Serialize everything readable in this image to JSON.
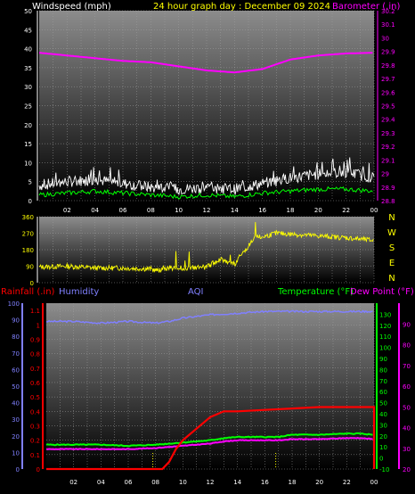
{
  "header": {
    "windspeed_label": "Windspeed (mph)",
    "title": "24 hour graph day : December 09 2024",
    "barometer_label": "Barometer (.in)"
  },
  "lower_header": {
    "rainfall_label": "Rainfall (.in)",
    "humidity_label": "Humidity",
    "aqi_label": "AQI",
    "temperature_label": "Temperature (°F)",
    "dewpoint_label": "Dew Point (°F)"
  },
  "direction_labels": [
    "N",
    "W",
    "S",
    "E",
    "N"
  ],
  "colors": {
    "wind_avg": "#00ff00",
    "wind_gust": "#ffffff",
    "barometer": "#ff00ff",
    "direction": "#ffff00",
    "rainfall": "#ff0000",
    "humidity": "#8080ff",
    "temperature": "#00ff00",
    "dewpoint": "#ff00ff",
    "title": "#ffff00",
    "aqi": "#8080ff",
    "rain_markers": "#ffff00"
  },
  "chart_data": [
    {
      "type": "line",
      "name": "wind-barometer",
      "x_ticks": [
        "02",
        "04",
        "06",
        "08",
        "10",
        "12",
        "14",
        "16",
        "18",
        "20",
        "22",
        "00"
      ],
      "xlim": [
        0,
        24
      ],
      "left_axis": {
        "label": "Windspeed (mph)",
        "ylim": [
          0,
          50
        ],
        "ticks": [
          "0",
          "5",
          "10",
          "15",
          "20",
          "25",
          "30",
          "35",
          "40",
          "45",
          "50"
        ]
      },
      "right_axis": {
        "label": "Barometer (.in)",
        "ylim": [
          28.8,
          30.2
        ],
        "ticks": [
          "28.8",
          "28.9",
          "29",
          "29.1",
          "29.2",
          "29.3",
          "29.4",
          "29.5",
          "29.6",
          "29.7",
          "29.8",
          "29.9",
          "30",
          "30.1",
          "30.2"
        ]
      },
      "series": [
        {
          "name": "Barometer (.in)",
          "axis": "right",
          "x": [
            0,
            2,
            4,
            6,
            8,
            10,
            12,
            14,
            16,
            18,
            20,
            22,
            24
          ],
          "y": [
            29.89,
            29.87,
            29.85,
            29.83,
            29.82,
            29.79,
            29.76,
            29.745,
            29.77,
            29.84,
            29.87,
            29.885,
            29.89
          ]
        },
        {
          "name": "Windspeed (mph)",
          "axis": "left",
          "x": [
            0,
            2,
            4,
            6,
            8,
            10,
            12,
            14,
            16,
            18,
            20,
            22,
            24
          ],
          "y": [
            4,
            5,
            5.5,
            4.5,
            3.5,
            3,
            3.5,
            3,
            4.5,
            6,
            7,
            7.5,
            6
          ],
          "peak": [
            7,
            8,
            10,
            8,
            6,
            5,
            5,
            5,
            8,
            10,
            11,
            12,
            10
          ]
        },
        {
          "name": "Wind Avg",
          "x": [
            0,
            2,
            4,
            6,
            8,
            10,
            12,
            14,
            16,
            18,
            20,
            22,
            24
          ],
          "y": [
            1.5,
            2,
            2.5,
            2,
            1.5,
            1,
            1.5,
            1,
            2,
            2.5,
            3,
            3,
            2.5
          ]
        }
      ]
    },
    {
      "type": "scatter",
      "name": "wind-direction",
      "ylim": [
        0,
        360
      ],
      "y_ticks": [
        "0",
        "90",
        "180",
        "270",
        "360"
      ],
      "series": [
        {
          "name": "Direction",
          "x": [
            0,
            2,
            4,
            6,
            8,
            8.5,
            9,
            10,
            11,
            12,
            13,
            14,
            15,
            15.5,
            16,
            17,
            18,
            20,
            22,
            24
          ],
          "y": [
            85,
            90,
            80,
            80,
            75,
            65,
            80,
            80,
            80,
            85,
            130,
            100,
            200,
            245,
            250,
            270,
            265,
            255,
            245,
            230
          ]
        }
      ]
    },
    {
      "type": "line",
      "name": "rain-humidity-temperature",
      "x_ticks": [
        "02",
        "04",
        "06",
        "08",
        "10",
        "12",
        "14",
        "16",
        "18",
        "20",
        "22",
        "00"
      ],
      "xlim": [
        0,
        24
      ],
      "rain_axis": {
        "ylim": [
          0,
          1.15
        ],
        "ticks": [
          "0",
          "0.1",
          "0.2",
          "0.3",
          "0.4",
          "0.5",
          "0.6",
          "0.7",
          "0.8",
          "0.9",
          "1",
          "1.1"
        ]
      },
      "humidity_axis": {
        "ylim": [
          0,
          100
        ],
        "ticks": [
          "0",
          "10",
          "20",
          "30",
          "40",
          "50",
          "60",
          "70",
          "80",
          "90",
          "100"
        ]
      },
      "temp_axis": {
        "ylim": [
          -10,
          140
        ],
        "ticks": [
          "-10",
          "0",
          "10",
          "20",
          "30",
          "40",
          "50",
          "60",
          "70",
          "80",
          "90",
          "100",
          "110",
          "120",
          "130"
        ]
      },
      "dew_axis": {
        "ylim": [
          20,
          100
        ],
        "ticks": [
          "20",
          "30",
          "40",
          "50",
          "60",
          "70",
          "80",
          "90"
        ]
      },
      "series": [
        {
          "name": "Humidity",
          "axis": "humidity",
          "x": [
            0,
            2,
            4,
            6,
            8,
            9,
            10,
            11,
            12,
            14,
            16,
            18,
            20,
            22,
            24
          ],
          "y": [
            89,
            89,
            88,
            89,
            88,
            89,
            91,
            92,
            93,
            94,
            95,
            95,
            95,
            95,
            95
          ]
        },
        {
          "name": "Rainfall (.in)",
          "axis": "rain",
          "x": [
            0,
            8.5,
            9.0,
            9.5,
            10,
            11,
            12,
            13,
            14,
            16,
            18,
            20,
            24,
            24
          ],
          "y": [
            0,
            0,
            0.05,
            0.14,
            0.2,
            0.28,
            0.36,
            0.4,
            0.4,
            0.41,
            0.42,
            0.43,
            0.43,
            0
          ]
        },
        {
          "name": "Temperature (°F)",
          "axis": "temp",
          "x": [
            0,
            2,
            4,
            6,
            8,
            9,
            10,
            11,
            12,
            13,
            14,
            16,
            17,
            18,
            20,
            22,
            23,
            24
          ],
          "y": [
            12,
            12,
            12,
            11,
            12,
            13,
            14,
            15,
            16,
            18,
            19,
            19,
            19,
            21,
            21,
            22,
            22,
            21
          ]
        },
        {
          "name": "Dew Point (°F)",
          "axis": "temp",
          "x": [
            0,
            2,
            4,
            6,
            8,
            9,
            10,
            11,
            12,
            13,
            14,
            16,
            17,
            18,
            20,
            22,
            23,
            24
          ],
          "y": [
            8,
            8,
            8,
            8,
            9,
            10,
            11,
            12,
            13,
            15,
            16,
            16,
            16,
            17,
            17,
            18,
            18,
            17
          ]
        }
      ],
      "rain_markers": [
        7.8,
        16.8
      ]
    }
  ]
}
